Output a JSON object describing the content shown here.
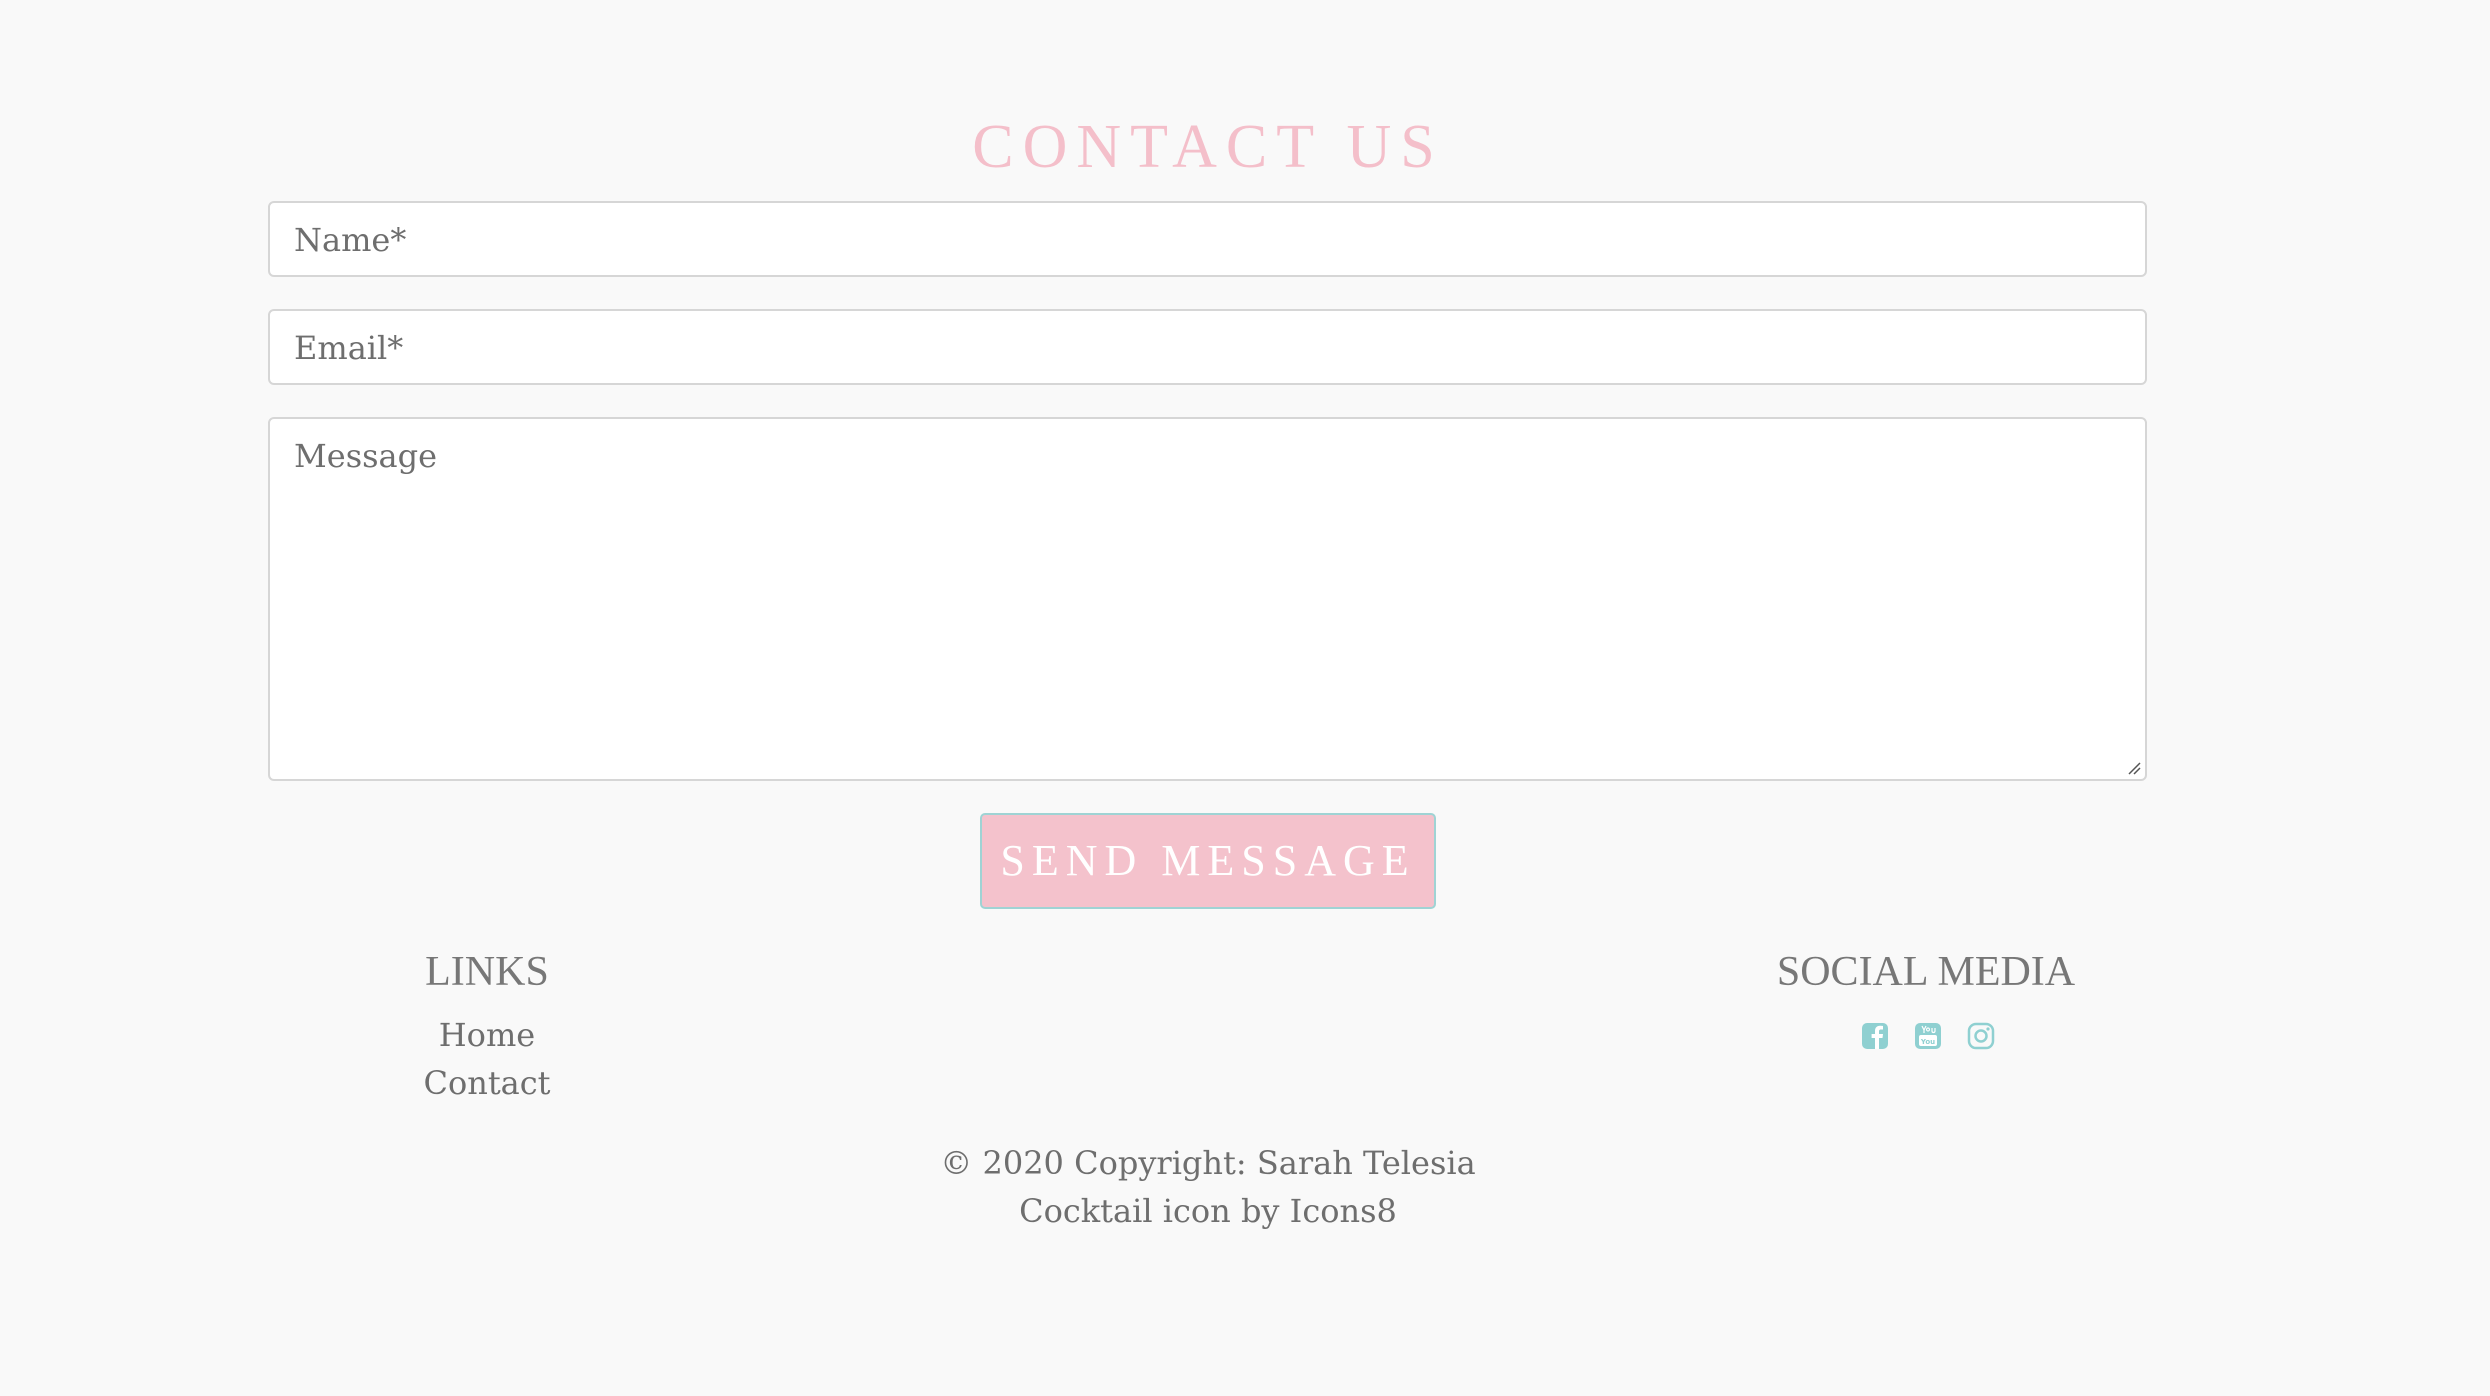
{
  "contact": {
    "title": "CONTACT US",
    "name_placeholder": "Name*",
    "email_placeholder": "Email*",
    "message_placeholder": "Message",
    "send_label": "SEND MESSAGE"
  },
  "footer": {
    "links_heading": "LINKS",
    "links": [
      {
        "label": "Home"
      },
      {
        "label": "Contact"
      }
    ],
    "social_heading": "SOCIAL MEDIA",
    "social_icons": [
      "facebook-icon",
      "youtube-icon",
      "instagram-icon"
    ],
    "copyright": "© 2020 Copyright: Sarah Telesia",
    "credit": "Cocktail icon by Icons8"
  },
  "colors": {
    "title_pink": "#f4bfca",
    "button_pink": "#f4c2cc",
    "accent_teal": "#8fd0d1",
    "text_gray": "#6e6e6e",
    "background": "#f9f9f9"
  }
}
